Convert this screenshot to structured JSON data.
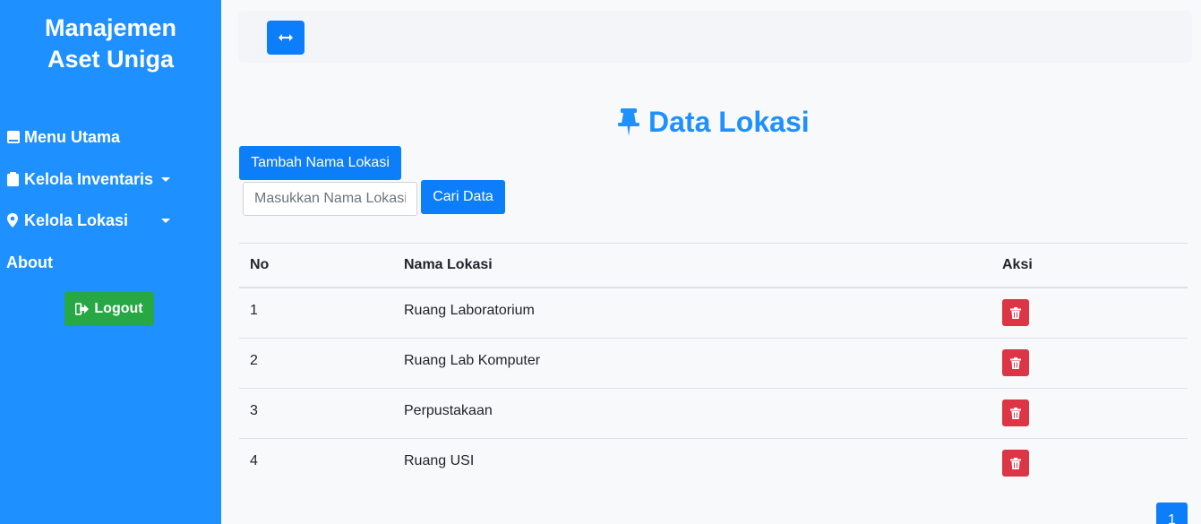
{
  "sidebar": {
    "brand_line1": "Manajemen",
    "brand_line2": "Aset Uniga",
    "items": [
      {
        "label": "Menu Utama",
        "icon": "book-icon"
      },
      {
        "label": "Kelola Inventaris",
        "icon": "clipboard-icon",
        "has_dropdown": true
      },
      {
        "label": "Kelola Lokasi",
        "icon": "map-marker-icon",
        "has_dropdown": true
      },
      {
        "label": "About"
      }
    ],
    "logout_label": "Logout",
    "color": "#1e90ff"
  },
  "topbar": {
    "toggle_icon": "arrows-horizontal-icon"
  },
  "main": {
    "title": "Data Lokasi",
    "title_icon": "pushpin-icon",
    "add_label": "Tambah Nama Lokasi",
    "search": {
      "placeholder": "Masukkan Nama Lokasi",
      "value": "",
      "button_label": "Cari Data"
    },
    "table": {
      "headers": [
        "No",
        "Nama Lokasi",
        "Aksi"
      ],
      "rows": [
        {
          "no": "1",
          "name": "Ruang Laboratorium"
        },
        {
          "no": "2",
          "name": "Ruang Lab Komputer"
        },
        {
          "no": "3",
          "name": "Perpustakaan"
        },
        {
          "no": "4",
          "name": "Ruang USI"
        }
      ],
      "delete_icon": "trash-icon"
    },
    "pagination": {
      "current": "1"
    }
  },
  "colors": {
    "primary": "#0d7ef9",
    "danger": "#dc3545",
    "success": "#28a745",
    "accent": "#1e90ff"
  }
}
